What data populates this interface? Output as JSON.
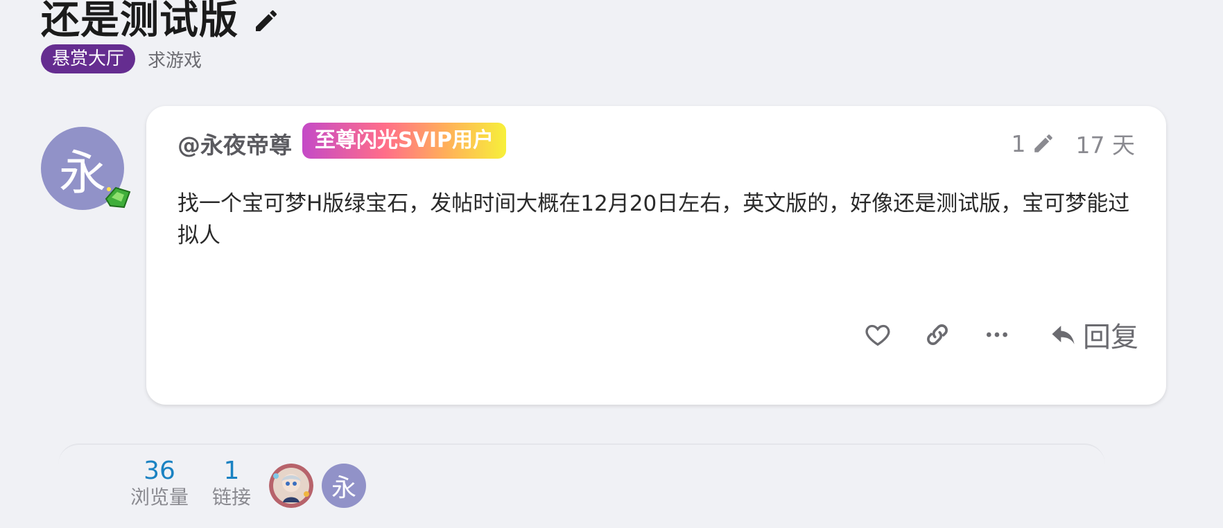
{
  "topic": {
    "title": "还是测试版",
    "category": "悬赏大厅",
    "tag": "求游戏"
  },
  "post": {
    "avatar_letter": "永",
    "username": "@永夜帝尊",
    "user_title": "至尊闪光SVIP用户",
    "edit_count": "1",
    "age": "17 天",
    "body": "找一个宝可梦H版绿宝石，发帖时间大概在12月20日左右，英文版的，好像还是测试版，宝可梦能过拟人",
    "reply_label": "回复"
  },
  "topic_map": {
    "views_count": "36",
    "views_label": "浏览量",
    "links_count": "1",
    "links_label": "链接",
    "participant_letter": "永"
  },
  "colors": {
    "category": "#652d90",
    "avatar": "#9192c8",
    "stat_number": "#1a82c2"
  }
}
